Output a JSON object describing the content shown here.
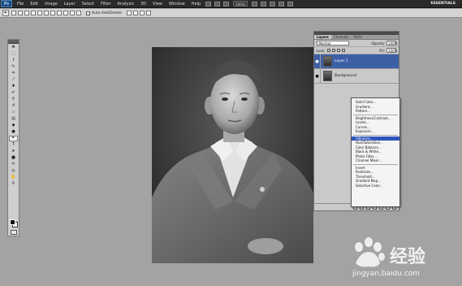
{
  "app": {
    "logo": "Ps",
    "menu": [
      "File",
      "Edit",
      "Image",
      "Layer",
      "Select",
      "Filter",
      "Analysis",
      "3D",
      "View",
      "Window",
      "Help"
    ],
    "zoom": "100%",
    "workspace": "ESSENTIALS"
  },
  "options_bar": {
    "auto_add_delete_label": "Auto Add/Delete"
  },
  "tools": [
    "move",
    "marquee",
    "lasso",
    "quick-select",
    "crop",
    "eyedropper",
    "healing",
    "brush",
    "clone-stamp",
    "history-brush",
    "eraser",
    "gradient",
    "blur",
    "dodge",
    "pen",
    "type",
    "path-select",
    "shape",
    "3d-rotate",
    "3d-orbit",
    "hand",
    "zoom"
  ],
  "layers_panel": {
    "tabs": [
      "Layers",
      "Channels",
      "Paths"
    ],
    "blend_mode": "Normal",
    "opacity_label": "Opacity:",
    "opacity": "100%",
    "lock_label": "Lock:",
    "fill_label": "Fill:",
    "fill": "100%",
    "layers": [
      {
        "name": "Layer 1",
        "selected": true
      },
      {
        "name": "Background",
        "selected": false
      }
    ]
  },
  "adjustment_menu": {
    "items": [
      "Solid Color...",
      "Gradient...",
      "Pattern...",
      "---",
      "Brightness/Contrast...",
      "Levels...",
      "Curves...",
      "Exposure...",
      "---",
      "Vibrance...",
      "Hue/Saturation...",
      "Color Balance...",
      "Black & White...",
      "Photo Filter...",
      "Channel Mixer...",
      "---",
      "Invert",
      "Posterize...",
      "Threshold...",
      "Gradient Map...",
      "Selective Color..."
    ],
    "highlighted": "Vibrance..."
  },
  "watermark": {
    "cn": "经验",
    "url": "jingyan.baidu.com"
  },
  "colors": {
    "menubar": "#2a2a2a",
    "canvas_bg": "#a3a3a3",
    "selection": "#3d5fa6"
  }
}
